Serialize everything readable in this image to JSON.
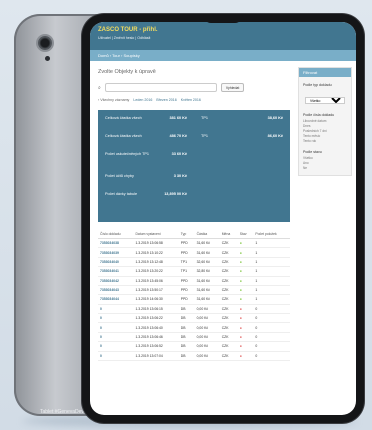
{
  "back_tablet": {
    "brand": "Tablet #GenevaDev#"
  },
  "app": {
    "site_title": "ZASCO TOUR - přihl.",
    "user_tools": "Uživatel | Změnit heslo | Odhlásit",
    "breadcrumbs": "Domů › Tour › Soupisky",
    "page_title": "Zvolte Objekty k úpravě"
  },
  "search": {
    "placeholder": "",
    "button_label": "Vyhledat"
  },
  "date_hierarchy": {
    "label": "‹ Všechny záznamy",
    "items": [
      "Leden 2016",
      "Březen 2016",
      "Květen 2016"
    ]
  },
  "summary": {
    "rows": [
      {
        "label": "Celková částka všech",
        "value": "381 60 Kč",
        "label2": "TP1",
        "value2": "38,60 Kč"
      },
      {
        "label": "Celková částka všech",
        "value": "486 70 Kč",
        "label2": "TP1",
        "value2": "86,60 Kč"
      },
      {
        "label": "Počet uskutečněných TP1",
        "value": "33 60 Kč",
        "label2": "",
        "value2": ""
      },
      {
        "label": "Počet účtů chyby",
        "value": "3 30 Kč",
        "label2": "",
        "value2": ""
      },
      {
        "label": "Počet dávky tabule",
        "value": "13,895 00 Kč",
        "label2": "",
        "value2": ""
      }
    ]
  },
  "table": {
    "headers": [
      "Číslo dokladu",
      "Datum vystavení",
      "Typ",
      "Částka",
      "Měna",
      "Stav",
      "Počet položek"
    ],
    "rows": [
      {
        "doc": "7353034038",
        "date": "1.3.2019 13:06:58",
        "type": "PPD",
        "amount": "31,60 Kč",
        "currency": "CZK",
        "ok": true,
        "count": "1"
      },
      {
        "doc": "7353034039",
        "date": "1.3.2019 13:10:22",
        "type": "PPD",
        "amount": "31,60 Kč",
        "currency": "CZK",
        "ok": true,
        "count": "1"
      },
      {
        "doc": "7353034040",
        "date": "1.3.2019 13:12:48",
        "type": "TP1",
        "amount": "32,60 Kč",
        "currency": "CZK",
        "ok": true,
        "count": "1"
      },
      {
        "doc": "7353034041",
        "date": "1.3.2019 13:20:22",
        "type": "TP1",
        "amount": "32,80 Kč",
        "currency": "CZK",
        "ok": true,
        "count": "1"
      },
      {
        "doc": "7353034042",
        "date": "1.3.2019 13:45:06",
        "type": "PPD",
        "amount": "31,60 Kč",
        "currency": "CZK",
        "ok": true,
        "count": "1"
      },
      {
        "doc": "7353034043",
        "date": "1.3.2019 13:50:17",
        "type": "PPD",
        "amount": "31,60 Kč",
        "currency": "CZK",
        "ok": true,
        "count": "1"
      },
      {
        "doc": "7353034044",
        "date": "1.3.2019 14:06:30",
        "type": "PPD",
        "amount": "31,60 Kč",
        "currency": "CZK",
        "ok": true,
        "count": "1"
      },
      {
        "doc": "0",
        "date": "1.3.2019 13:06:15",
        "type": "DB",
        "amount": "0,00 Kč",
        "currency": "CZK",
        "ok": false,
        "count": "0"
      },
      {
        "doc": "0",
        "date": "1.3.2019 13:06:22",
        "type": "DB",
        "amount": "0,00 Kč",
        "currency": "CZK",
        "ok": false,
        "count": "0"
      },
      {
        "doc": "0",
        "date": "1.3.2019 13:06:40",
        "type": "DB",
        "amount": "0,00 Kč",
        "currency": "CZK",
        "ok": false,
        "count": "0"
      },
      {
        "doc": "0",
        "date": "1.3.2019 13:06:46",
        "type": "DB",
        "amount": "0,00 Kč",
        "currency": "CZK",
        "ok": false,
        "count": "0"
      },
      {
        "doc": "0",
        "date": "1.3.2019 13:06:52",
        "type": "DB",
        "amount": "0,00 Kč",
        "currency": "CZK",
        "ok": false,
        "count": "0"
      },
      {
        "doc": "0",
        "date": "1.3.2019 13:07:04",
        "type": "DB",
        "amount": "0,00 Kč",
        "currency": "CZK",
        "ok": false,
        "count": "0"
      }
    ]
  },
  "filter": {
    "title": "Filtrovat",
    "section1": "Podle typ dokladu",
    "select_value": "Všetko",
    "section2": "Podle čísla dokladu",
    "list2": [
      "Libovolné datum",
      "Dnes",
      "Posledních 7 dní",
      "Tento měsíc",
      "Tento rok"
    ],
    "section3": "Podle stavu",
    "list3": [
      "Všetko",
      "Ano",
      "Ne"
    ]
  },
  "colors": {
    "header": "#417690",
    "accent": "#79aec8",
    "title_yellow": "#f5dd5d"
  }
}
